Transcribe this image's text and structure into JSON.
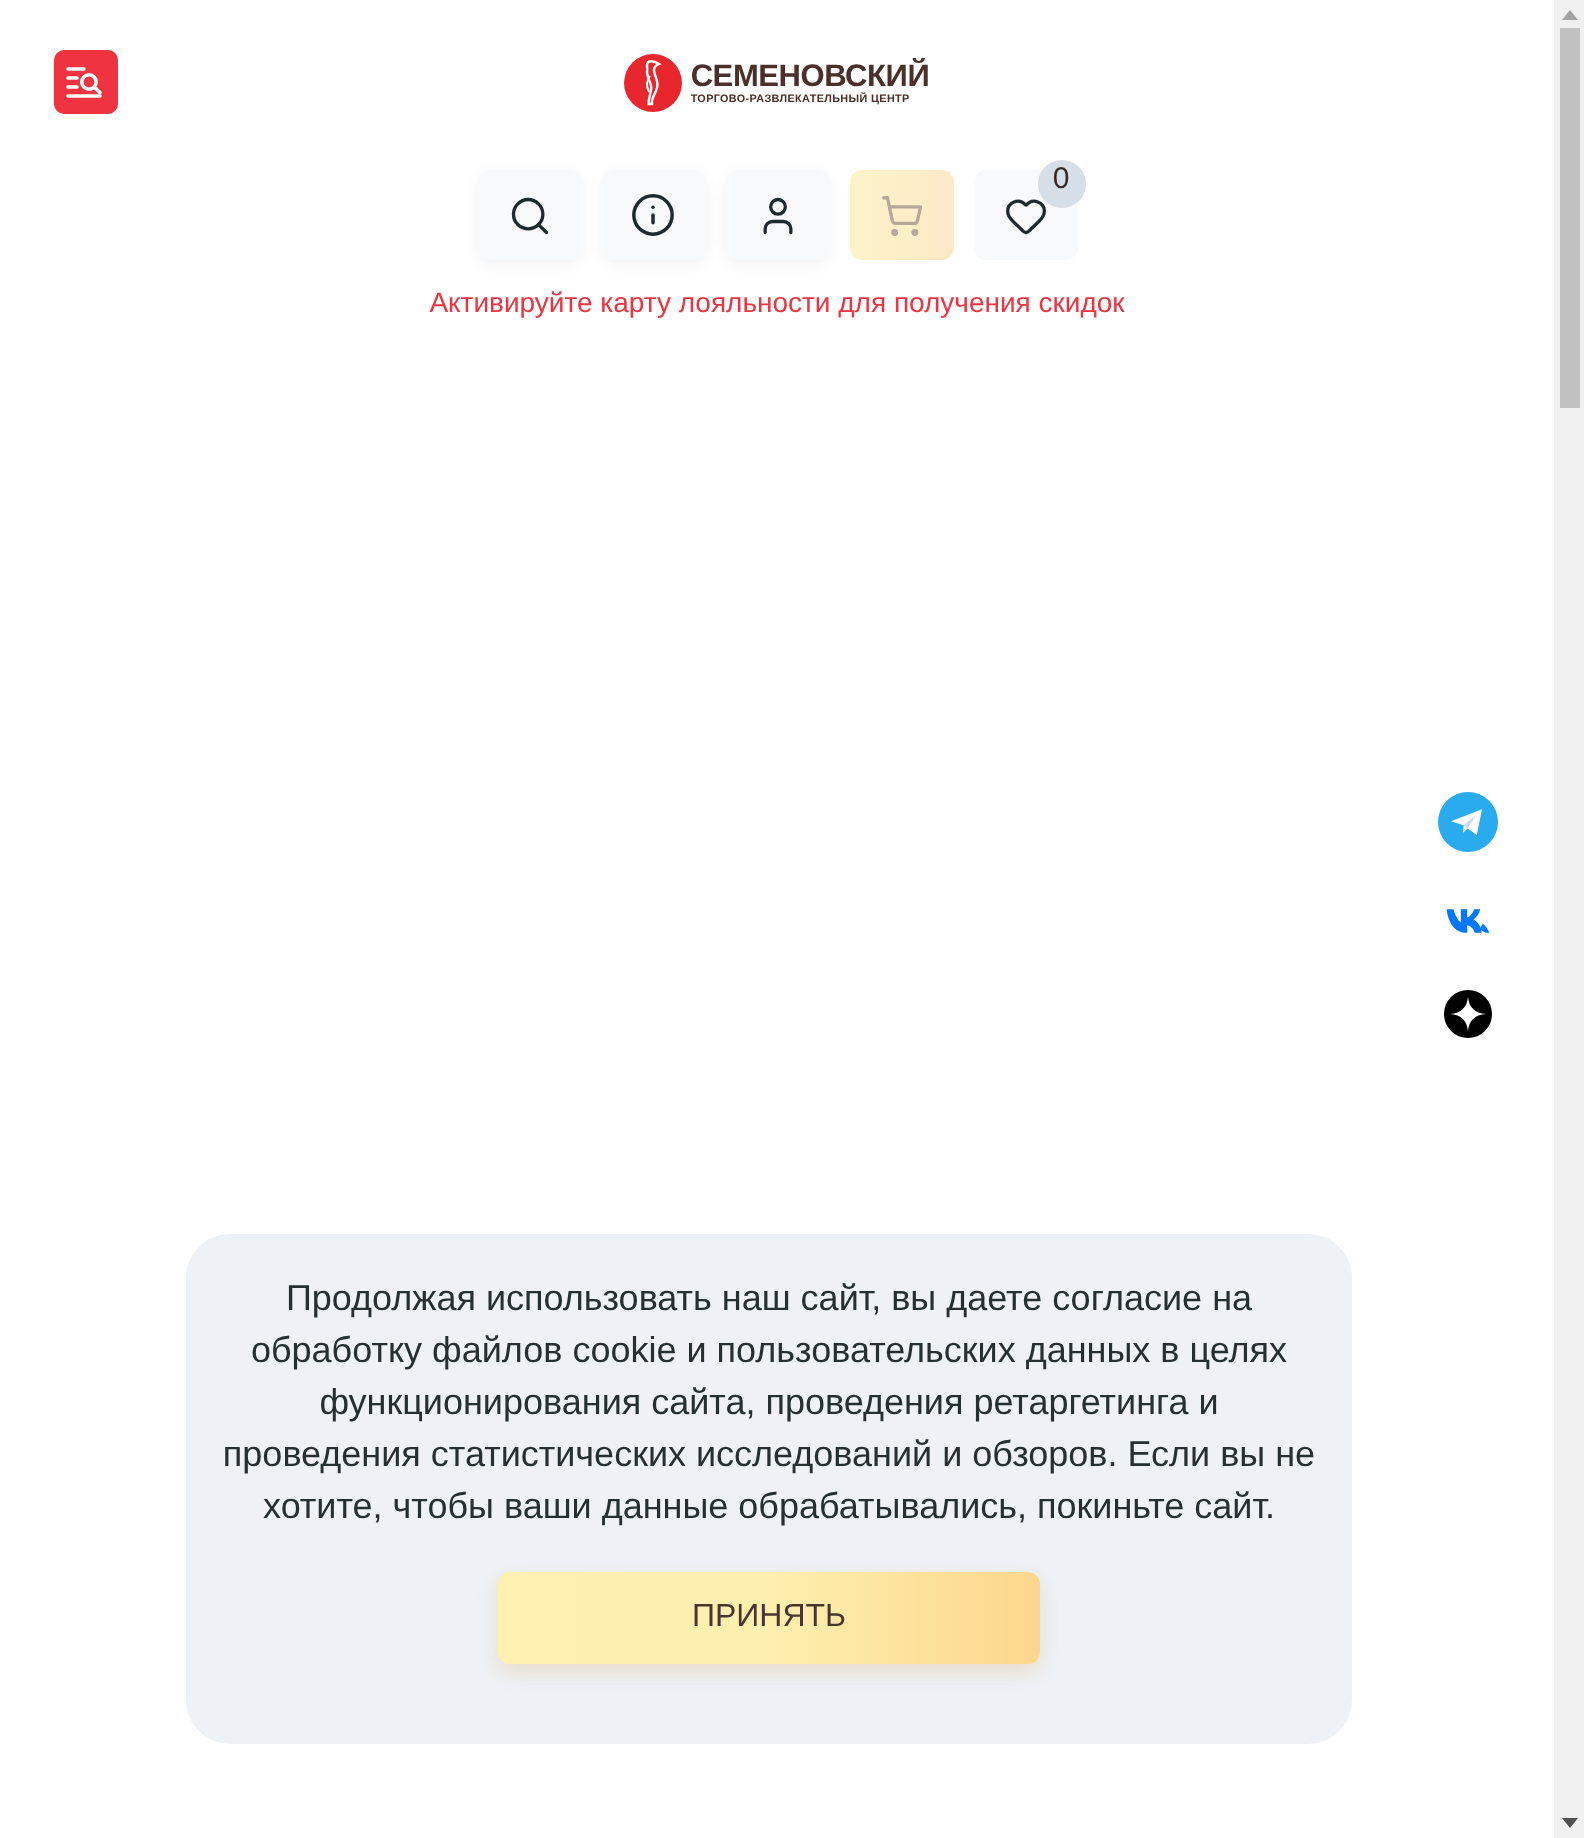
{
  "logo": {
    "title": "СЕМЕНОВСКИЙ",
    "subtitle": "ТОРГОВО-РАЗВЛЕКАТЕЛЬНЫЙ ЦЕНТР"
  },
  "toolbar": [
    {
      "kind": "search",
      "disabled": false
    },
    {
      "kind": "info",
      "disabled": false
    },
    {
      "kind": "account",
      "disabled": false
    },
    {
      "kind": "cart",
      "disabled": true
    },
    {
      "kind": "favorites",
      "disabled": false,
      "badge": "0"
    }
  ],
  "loyalty_notice": "Активируйте карту лояльности для получения скидок",
  "social_links": [
    {
      "kind": "telegram"
    },
    {
      "kind": "vk"
    },
    {
      "kind": "zen"
    }
  ],
  "cookie_banner": {
    "message": "Продолжая использовать наш сайт, вы даете согласие на обработку файлов cookie и пользовательских данных в целях функционирования сайта, проведения ретаргетинга и проведения статистических исследований и обзоров. Если вы не хотите, чтобы ваши данные обрабатывались, покиньте сайт.",
    "button": "ПРИНЯТЬ"
  }
}
